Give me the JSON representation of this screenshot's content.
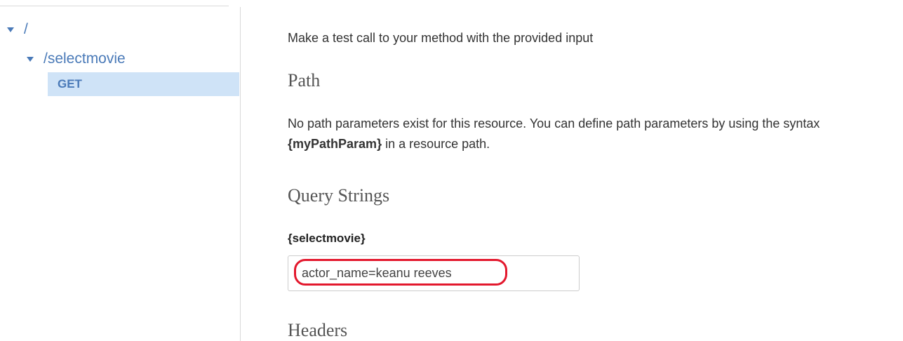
{
  "sidebar": {
    "tree": {
      "root_label": "/",
      "resource_label": "/selectmovie",
      "method_label": "GET"
    }
  },
  "main": {
    "intro": "Make a test call to your method with the provided input",
    "path": {
      "heading": "Path",
      "desc_before": "No path parameters exist for this resource. You can define path parameters by using the syntax ",
      "desc_param": "{myPathParam}",
      "desc_after": " in a resource path."
    },
    "query": {
      "heading": "Query Strings",
      "param_label": "{selectmovie}",
      "value": "actor_name=keanu reeves"
    },
    "headers": {
      "heading": "Headers"
    }
  },
  "colors": {
    "link": "#4a7ab8",
    "selected_bg": "#cfe3f7",
    "annotation_ring": "#e3182d"
  }
}
